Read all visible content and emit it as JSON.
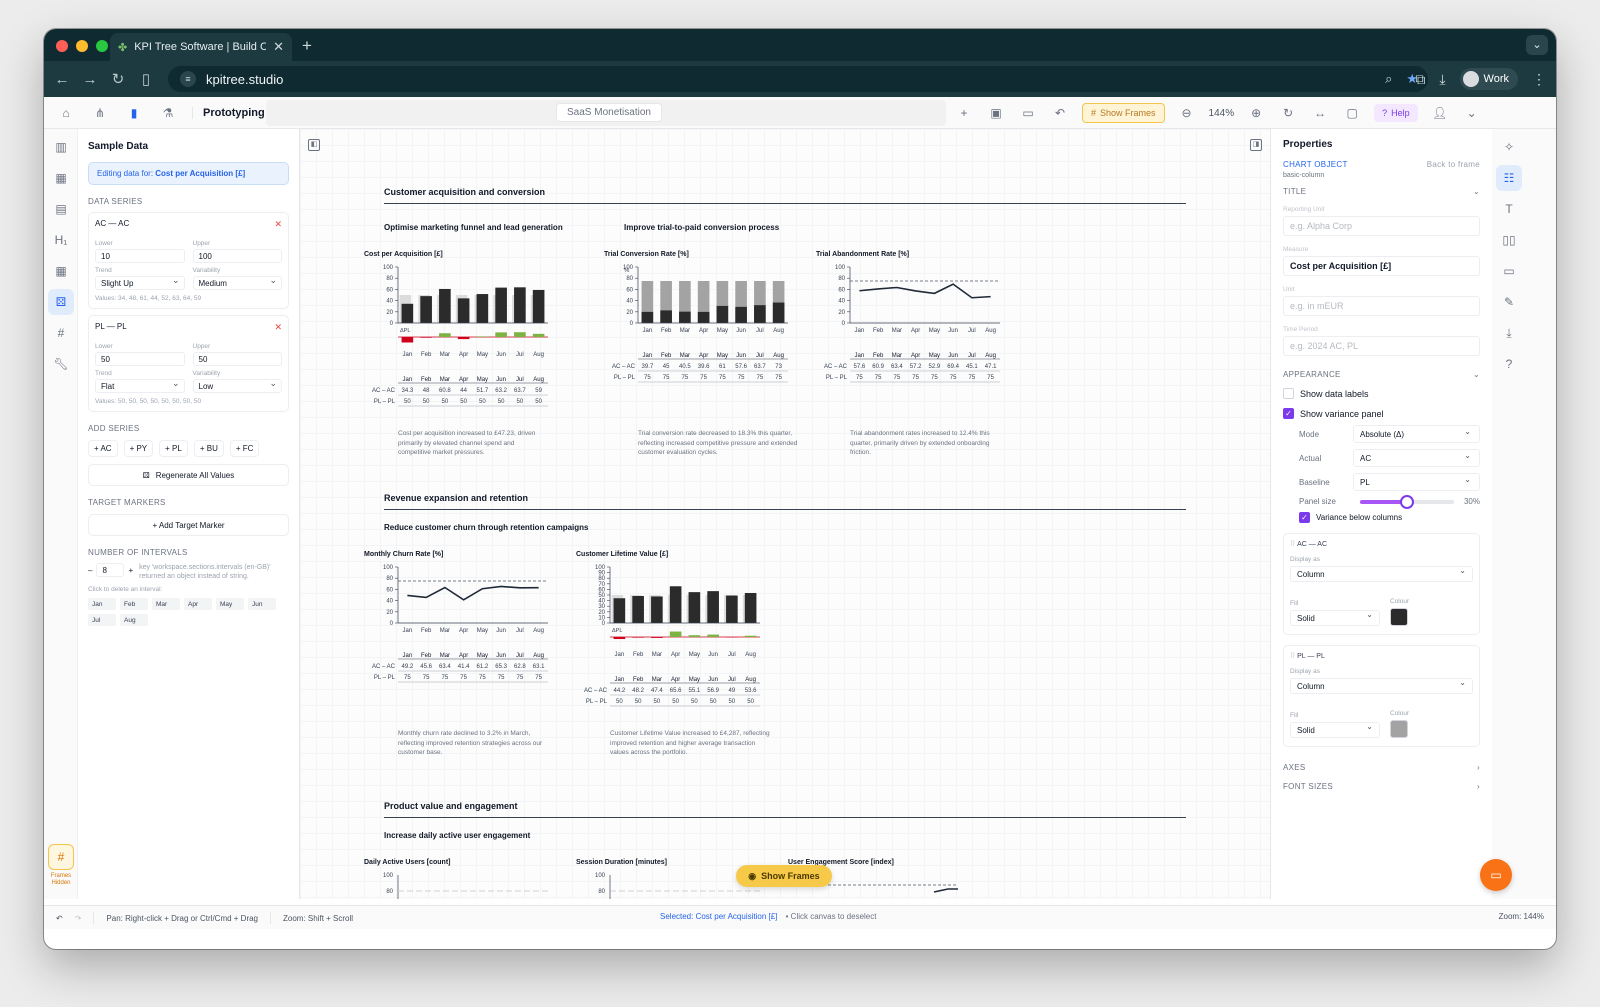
{
  "browser": {
    "tab_title": "KPI Tree Software | Build Clie",
    "url": "kpitree.studio",
    "profile": "Work"
  },
  "toolbar": {
    "mode": "Prototyping",
    "doc_name": "SaaS Monetisation",
    "show_frames": "Show Frames",
    "zoom": "144%",
    "help": "Help"
  },
  "sample_data": {
    "title": "Sample Data",
    "editing_prefix": "Editing data for: ",
    "editing_target": "Cost per Acquisition [£]",
    "data_series_label": "DATA SERIES",
    "lower_label": "Lower",
    "upper_label": "Upper",
    "trend_label": "Trend",
    "variability_label": "Variability",
    "series": [
      {
        "name": "AC — AC",
        "lower": "10",
        "upper": "100",
        "trend": "Slight Up",
        "variability": "Medium",
        "values": "Values: 34, 48, 61, 44, 52, 63, 64, 59"
      },
      {
        "name": "PL — PL",
        "lower": "50",
        "upper": "50",
        "trend": "Flat",
        "variability": "Low",
        "values": "Values: 50, 50, 50, 50, 50, 50, 50, 50"
      }
    ],
    "add_series_label": "ADD SERIES",
    "add_series": [
      "+ AC",
      "+ PY",
      "+ PL",
      "+ BU",
      "+ FC"
    ],
    "regenerate": "Regenerate All Values",
    "target_markers_label": "TARGET MARKERS",
    "add_target": "+ Add Target Marker",
    "intervals_label": "NUMBER OF INTERVALS",
    "intervals_value": "8",
    "intervals_warning": "key 'workspace.sections.intervals (en-GB)' returned an object instead of string.",
    "click_delete": "Click to delete an interval:",
    "months": [
      "Jan",
      "Feb",
      "Mar",
      "Apr",
      "May",
      "Jun",
      "Jul",
      "Aug"
    ]
  },
  "canvas": {
    "sections": [
      {
        "title": "Customer acquisition and conversion",
        "subheads": [
          "Optimise marketing funnel and lead generation",
          "Improve trial-to-paid conversion process"
        ]
      },
      {
        "title": "Revenue expansion and retention",
        "subheads": [
          "Reduce customer churn through retention campaigns"
        ]
      },
      {
        "title": "Product value and engagement",
        "subheads": [
          "Increase daily active user engagement"
        ]
      }
    ],
    "captions": {
      "cpa": "Cost per acquisition increased to £47.23, driven primarily by elevated channel spend and competitive market pressures.",
      "tcr": "Trial conversion rate decreased to 18.3% this quarter, reflecting increased competitive pressure and extended customer evaluation cycles.",
      "tar": "Trial abandonment rates increased to 12.4% this quarter, primarily driven by extended onboarding friction.",
      "churn": "Monthly churn rate declined to 3.2% in March, reflecting improved retention strategies across our customer base.",
      "clv": "Customer Lifetime Value increased to £4,287, reflecting improved retention and higher average transaction values across the portfolio."
    },
    "floating_button": "Show Frames"
  },
  "chart_data": [
    {
      "id": "cpa",
      "type": "bar",
      "title": "Cost per Acquisition [£]",
      "categories": [
        "Jan",
        "Feb",
        "Mar",
        "Apr",
        "May",
        "Jun",
        "Jul",
        "Aug"
      ],
      "ylim": [
        0,
        100
      ],
      "yticks": [
        0,
        20,
        40,
        60,
        80,
        100
      ],
      "series": [
        {
          "name": "AC — AC",
          "values": [
            34.3,
            48,
            60.8,
            44,
            51.7,
            63.2,
            63.7,
            59
          ]
        },
        {
          "name": "PL — PL",
          "values": [
            50,
            50,
            50,
            50,
            50,
            50,
            50,
            50
          ]
        }
      ],
      "variance": {
        "label": "ΔPL",
        "values": [
          -15.7,
          -2,
          10.8,
          -6,
          1.7,
          13.2,
          13.7,
          9
        ]
      },
      "table_values": [
        [
          "34.3",
          "48",
          "60.8",
          "44",
          "51.7",
          "63.2",
          "63.7",
          "59"
        ],
        [
          "50",
          "50",
          "50",
          "50",
          "50",
          "50",
          "50",
          "50"
        ]
      ]
    },
    {
      "id": "tcr",
      "type": "bar",
      "title": "Trial Conversion Rate [%]",
      "unit_label": "%",
      "categories": [
        "Jan",
        "Feb",
        "Mar",
        "Apr",
        "May",
        "Jun",
        "Jul",
        "Aug"
      ],
      "ylim": [
        0,
        100
      ],
      "yticks": [
        0,
        20,
        40,
        60,
        80,
        100
      ],
      "series": [
        {
          "name": "AC — AC",
          "values": [
            39.7,
            45,
            40.5,
            39.6,
            61,
            57.6,
            63.7,
            73
          ]
        },
        {
          "name": "PL — PL",
          "values": [
            75,
            75,
            75,
            75,
            75,
            75,
            75,
            75
          ]
        }
      ],
      "table_values": [
        [
          "39.7",
          "45",
          "40.5",
          "39.6",
          "61",
          "57.6",
          "63.7",
          "73"
        ],
        [
          "75",
          "75",
          "75",
          "75",
          "75",
          "75",
          "75",
          "75"
        ]
      ]
    },
    {
      "id": "tar",
      "type": "line",
      "title": "Trial Abandonment Rate [%]",
      "categories": [
        "Jan",
        "Feb",
        "Mar",
        "Apr",
        "May",
        "Jun",
        "Jul",
        "Aug"
      ],
      "ylim": [
        0,
        100
      ],
      "yticks": [
        0,
        20,
        40,
        60,
        80,
        100
      ],
      "series": [
        {
          "name": "AC — AC",
          "values": [
            57.6,
            60.9,
            63.4,
            57.2,
            52.9,
            69.4,
            45.1,
            47.1
          ]
        },
        {
          "name": "PL — PL",
          "values": [
            75,
            75,
            75,
            75,
            75,
            75,
            75,
            75
          ]
        }
      ],
      "table_values": [
        [
          "57.6",
          "60.9",
          "63.4",
          "57.2",
          "52.9",
          "69.4",
          "45.1",
          "47.1"
        ],
        [
          "75",
          "75",
          "75",
          "75",
          "75",
          "75",
          "75",
          "75"
        ]
      ]
    },
    {
      "id": "churn",
      "type": "line",
      "title": "Monthly Churn Rate [%]",
      "categories": [
        "Jan",
        "Feb",
        "Mar",
        "Apr",
        "May",
        "Jun",
        "Jul",
        "Aug"
      ],
      "ylim": [
        0,
        100
      ],
      "yticks": [
        0,
        20,
        40,
        60,
        80,
        100
      ],
      "series": [
        {
          "name": "AC — AC",
          "values": [
            49.2,
            45.6,
            63.4,
            41.4,
            61.2,
            65.3,
            62.8,
            63.1
          ]
        },
        {
          "name": "PL — PL",
          "values": [
            75,
            75,
            75,
            75,
            75,
            75,
            75,
            75
          ]
        }
      ],
      "table_values": [
        [
          "49.2",
          "45.6",
          "63.4",
          "41.4",
          "61.2",
          "65.3",
          "62.8",
          "63.1"
        ],
        [
          "75",
          "75",
          "75",
          "75",
          "75",
          "75",
          "75",
          "75"
        ]
      ]
    },
    {
      "id": "clv",
      "type": "bar",
      "title": "Customer Lifetime Value [£]",
      "categories": [
        "Jan",
        "Feb",
        "Mar",
        "Apr",
        "May",
        "Jun",
        "Jul",
        "Aug"
      ],
      "ylim": [
        0,
        100
      ],
      "yticks": [
        0,
        10,
        20,
        30,
        40,
        50,
        60,
        70,
        80,
        90,
        100
      ],
      "series": [
        {
          "name": "AC — AC",
          "values": [
            44.2,
            48.2,
            47.4,
            65.6,
            55.1,
            56.9,
            49,
            53.6
          ]
        },
        {
          "name": "PL — PL",
          "values": [
            50,
            50,
            50,
            50,
            50,
            50,
            50,
            50
          ]
        }
      ],
      "variance": {
        "label": "ΔPL",
        "values": [
          -5.8,
          -1.8,
          -2.6,
          15.6,
          5.1,
          6.9,
          -1,
          3.6
        ]
      },
      "table_values": [
        [
          "44.2",
          "48.2",
          "47.4",
          "65.6",
          "55.1",
          "56.9",
          "49",
          "53.6"
        ],
        [
          "50",
          "50",
          "50",
          "50",
          "50",
          "50",
          "50",
          "50"
        ]
      ]
    },
    {
      "id": "dau",
      "type": "bar",
      "title": "Daily Active Users [count]",
      "ylim": [
        0,
        100
      ],
      "yticks": [
        80,
        100
      ]
    },
    {
      "id": "session",
      "type": "bar",
      "title": "Session Duration [minutes]",
      "ylim": [
        0,
        100
      ],
      "yticks": [
        80,
        100
      ]
    },
    {
      "id": "engagement",
      "type": "line",
      "title": "User Engagement Score [index]"
    }
  ],
  "table_row_labels": [
    "AC – AC",
    "PL – PL"
  ],
  "properties": {
    "title": "Properties",
    "object_label": "CHART OBJECT",
    "back": "Back to frame",
    "object_type": "basic-column",
    "title_section": "TITLE",
    "reporting_unit_label": "Reporting Unit",
    "reporting_unit_placeholder": "e.g. Alpha Corp",
    "measure_label": "Measure",
    "measure_value": "Cost per Acquisition [£]",
    "unit_label": "Unit",
    "unit_placeholder": "e.g. in mEUR",
    "time_label": "Time Period",
    "time_placeholder": "e.g. 2024 AC, PL",
    "appearance": "APPEARANCE",
    "show_data_labels": "Show data labels",
    "show_variance": "Show variance panel",
    "mode_label": "Mode",
    "mode_value": "Absolute (Δ)",
    "actual_label": "Actual",
    "actual_value": "AC",
    "baseline_label": "Baseline",
    "baseline_value": "PL",
    "panel_size_label": "Panel size",
    "panel_size_value": "30%",
    "panel_size_fraction": 0.5,
    "variance_below": "Variance below columns",
    "series_cards": [
      {
        "name": "AC — AC",
        "display_label": "Display as",
        "display": "Column",
        "fill_label": "Fill",
        "fill": "Solid",
        "colour_label": "Colour",
        "colour": "#2b2b2b"
      },
      {
        "name": "PL — PL",
        "display_label": "Display as",
        "display": "Column",
        "fill_label": "Fill",
        "fill": "Solid",
        "colour_label": "Colour",
        "colour": "#a3a3a3"
      }
    ],
    "axes": "AXES",
    "font_sizes": "FONT SIZES"
  },
  "status": {
    "pan": "Pan: Right-click + Drag or Ctrl/Cmd + Drag",
    "zoom_hint": "Zoom: Shift + Scroll",
    "selected": "Selected: Cost per Acquisition [£]",
    "deselect": "• Click canvas to deselect",
    "zoom": "Zoom: 144%"
  },
  "colors": {
    "accent": "#2563eb",
    "purple": "#7c3aed",
    "positive": "#7cb342",
    "negative": "#d0021b",
    "actual": "#2b2b2b",
    "plan": "#a3a3a3"
  }
}
